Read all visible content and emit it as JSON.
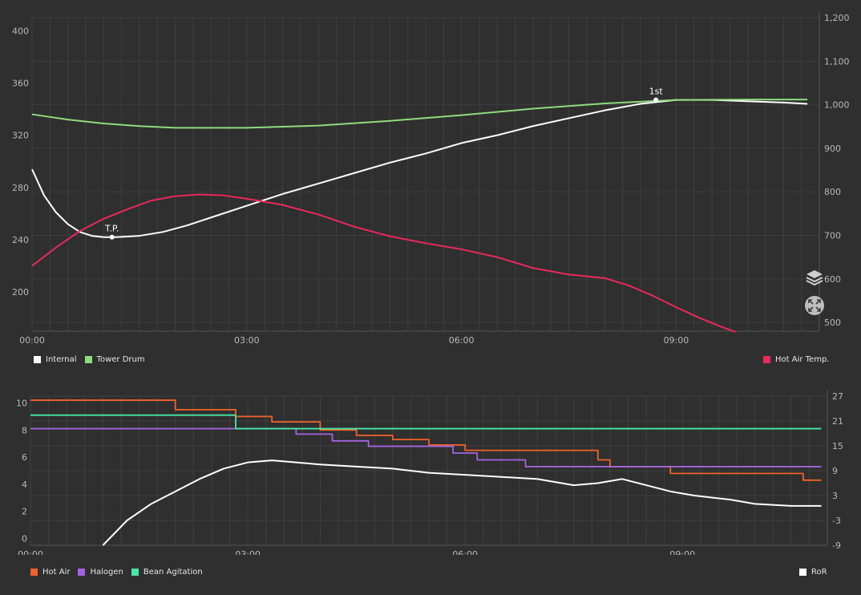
{
  "colors": {
    "background": "#2f2f2f",
    "grid": "#3f3f3f",
    "axis_text": "#b8b8b8"
  },
  "chart_data": [
    {
      "type": "line",
      "x_unit": "mm:ss",
      "xlim": [
        "00:00",
        "11:00"
      ],
      "ylim_left": [
        170,
        410
      ],
      "ylim_right": [
        480,
        1200
      ],
      "x_ticks": [
        "00:00",
        "03:00",
        "06:00",
        "09:00"
      ],
      "y_ticks_left": [
        "200",
        "240",
        "280",
        "320",
        "360",
        "400"
      ],
      "y_ticks_right": [
        "500",
        "600",
        "700",
        "800",
        "900",
        "1,000",
        "1,100",
        "1,200"
      ],
      "grid": true,
      "legend_left": [
        "Internal",
        "Tower Drum"
      ],
      "legend_right": [
        "Hot Air Temp."
      ],
      "series": [
        {
          "name": "Internal",
          "color": "#ffffff",
          "axis": "left",
          "points": [
            [
              "00:00",
              294
            ],
            [
              "00:10",
              274
            ],
            [
              "00:20",
              261
            ],
            [
              "00:30",
              252
            ],
            [
              "00:40",
              246
            ],
            [
              "00:50",
              243
            ],
            [
              "01:00",
              242
            ],
            [
              "01:10",
              242
            ],
            [
              "01:30",
              243
            ],
            [
              "01:50",
              246
            ],
            [
              "02:10",
              251
            ],
            [
              "02:30",
              257
            ],
            [
              "03:00",
              266
            ],
            [
              "03:30",
              275
            ],
            [
              "04:00",
              283
            ],
            [
              "04:30",
              291
            ],
            [
              "05:00",
              299
            ],
            [
              "05:30",
              306
            ],
            [
              "06:00",
              314
            ],
            [
              "06:30",
              320
            ],
            [
              "07:00",
              327
            ],
            [
              "07:30",
              333
            ],
            [
              "08:00",
              339
            ],
            [
              "08:30",
              344
            ],
            [
              "09:00",
              347
            ],
            [
              "09:30",
              347
            ],
            [
              "10:00",
              346
            ],
            [
              "10:30",
              345
            ],
            [
              "10:50",
              344
            ]
          ]
        },
        {
          "name": "Tower Drum",
          "color": "#8fdc7e",
          "axis": "right",
          "points": [
            [
              "00:00",
              978
            ],
            [
              "00:30",
              966
            ],
            [
              "01:00",
              957
            ],
            [
              "01:30",
              951
            ],
            [
              "02:00",
              947
            ],
            [
              "03:00",
              947
            ],
            [
              "04:00",
              952
            ],
            [
              "05:00",
              963
            ],
            [
              "06:00",
              976
            ],
            [
              "07:00",
              991
            ],
            [
              "08:00",
              1003
            ],
            [
              "09:00",
              1011
            ],
            [
              "10:00",
              1012
            ],
            [
              "10:50",
              1012
            ]
          ]
        },
        {
          "name": "Hot Air Temp.",
          "color": "#e8295a",
          "axis": "right",
          "points": [
            [
              "00:00",
              630
            ],
            [
              "00:20",
              672
            ],
            [
              "00:40",
              710
            ],
            [
              "01:00",
              738
            ],
            [
              "01:20",
              760
            ],
            [
              "01:40",
              780
            ],
            [
              "02:00",
              790
            ],
            [
              "02:20",
              794
            ],
            [
              "02:40",
              792
            ],
            [
              "03:00",
              784
            ],
            [
              "03:30",
              770
            ],
            [
              "04:00",
              748
            ],
            [
              "04:30",
              720
            ],
            [
              "05:00",
              698
            ],
            [
              "05:30",
              682
            ],
            [
              "06:00",
              668
            ],
            [
              "06:30",
              650
            ],
            [
              "07:00",
              625
            ],
            [
              "07:30",
              610
            ],
            [
              "08:00",
              602
            ],
            [
              "08:20",
              585
            ],
            [
              "08:40",
              562
            ],
            [
              "09:00",
              535
            ],
            [
              "09:20",
              510
            ],
            [
              "09:40",
              488
            ],
            [
              "09:50",
              478
            ]
          ]
        }
      ],
      "annotations": [
        {
          "label": "T.P.",
          "x": "01:07",
          "y": 242,
          "axis": "left"
        },
        {
          "label": "1st",
          "x": "08:43",
          "y": 347,
          "axis": "left"
        }
      ]
    },
    {
      "type": "line",
      "x_unit": "mm:ss",
      "xlim": [
        "00:00",
        "11:00"
      ],
      "ylim_left": [
        -0.5,
        10.5
      ],
      "ylim_right": [
        -9,
        27
      ],
      "x_ticks": [
        "00:00",
        "03:00",
        "06:00",
        "09:00"
      ],
      "y_ticks_left": [
        "0",
        "2",
        "4",
        "6",
        "8",
        "10"
      ],
      "y_ticks_right": [
        "-9",
        "-3",
        "3",
        "9",
        "15",
        "21",
        "27"
      ],
      "grid": true,
      "legend_left": [
        "Hot Air",
        "Halogen",
        "Bean Agitation"
      ],
      "legend_right": [
        "RoR"
      ],
      "series": [
        {
          "name": "Hot Air",
          "color": "#f0622b",
          "axis": "left",
          "step": true,
          "points": [
            [
              "00:00",
              10.2
            ],
            [
              "02:00",
              9.5
            ],
            [
              "02:50",
              9.0
            ],
            [
              "03:20",
              8.6
            ],
            [
              "04:00",
              8.0
            ],
            [
              "04:30",
              7.6
            ],
            [
              "05:00",
              7.3
            ],
            [
              "05:30",
              6.9
            ],
            [
              "06:00",
              6.5
            ],
            [
              "06:40",
              6.5
            ],
            [
              "07:50",
              5.8
            ],
            [
              "08:00",
              5.3
            ],
            [
              "08:50",
              4.8
            ],
            [
              "10:40",
              4.3
            ],
            [
              "10:55",
              4.3
            ]
          ]
        },
        {
          "name": "Halogen",
          "color": "#a463e0",
          "axis": "left",
          "step": true,
          "points": [
            [
              "00:00",
              8.1
            ],
            [
              "03:40",
              7.7
            ],
            [
              "04:10",
              7.2
            ],
            [
              "04:40",
              6.8
            ],
            [
              "05:50",
              6.3
            ],
            [
              "06:10",
              5.8
            ],
            [
              "06:50",
              5.3
            ],
            [
              "10:55",
              5.3
            ]
          ]
        },
        {
          "name": "Bean Agitation",
          "color": "#47e8a6",
          "axis": "left",
          "step": true,
          "points": [
            [
              "00:00",
              9.1
            ],
            [
              "02:50",
              8.1
            ],
            [
              "10:55",
              8.1
            ]
          ]
        },
        {
          "name": "RoR",
          "color": "#ffffff",
          "axis": "right",
          "points": [
            [
              "01:00",
              -9
            ],
            [
              "01:10",
              -6
            ],
            [
              "01:20",
              -3
            ],
            [
              "01:40",
              1
            ],
            [
              "02:00",
              4
            ],
            [
              "02:20",
              7
            ],
            [
              "02:40",
              9.5
            ],
            [
              "03:00",
              11
            ],
            [
              "03:20",
              11.5
            ],
            [
              "03:40",
              11
            ],
            [
              "04:00",
              10.5
            ],
            [
              "04:30",
              10
            ],
            [
              "05:00",
              9.5
            ],
            [
              "05:30",
              8.5
            ],
            [
              "06:00",
              8
            ],
            [
              "06:30",
              7.5
            ],
            [
              "07:00",
              7
            ],
            [
              "07:30",
              5.5
            ],
            [
              "07:50",
              6
            ],
            [
              "08:10",
              7
            ],
            [
              "08:30",
              5.5
            ],
            [
              "08:50",
              4
            ],
            [
              "09:10",
              3
            ],
            [
              "09:40",
              2
            ],
            [
              "10:00",
              1
            ],
            [
              "10:30",
              0.5
            ],
            [
              "10:55",
              0.5
            ]
          ]
        }
      ]
    }
  ]
}
